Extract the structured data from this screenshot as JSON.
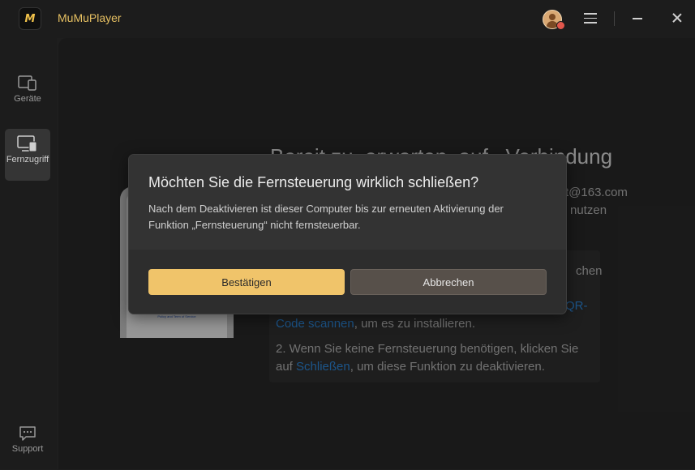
{
  "app": {
    "title": "MuMuPlayer",
    "logo_text": "M"
  },
  "titlebar": {
    "avatar_icon": "user-avatar-icon",
    "menu_icon": "hamburger-menu-icon",
    "minimize_icon": "minimize-icon",
    "close_icon": "close-icon"
  },
  "sidebar": {
    "items": [
      {
        "label": "Geräte",
        "icon": "devices-icon",
        "active": false
      },
      {
        "label": "Fernzugriff",
        "icon": "remote-access-icon",
        "active": true
      },
      {
        "label": "Support",
        "icon": "chat-support-icon",
        "active": false
      }
    ]
  },
  "background": {
    "heading": "Bereit zu..erwarten..auf...Verbindung",
    "email_fragment": "t@163.com",
    "use_fragment": "nutzen",
    "phone_policy": "Policy and Term of Service",
    "info": {
      "line1_end": "chen",
      "qr_fragment": "QR-",
      "code_link": "Code scannen",
      "line3_rest": ", um es zu installieren.",
      "line4": "2. Wenn Sie keine Fernsteuerung benötigen, klicken Sie",
      "line5_prefix": "auf ",
      "close_link": "Schließen",
      "line5_rest": ", um diese Funktion zu deaktivieren."
    }
  },
  "dialog": {
    "title": "Möchten Sie die Fernsteuerung wirklich schließen?",
    "message_line1": "Nach dem Deaktivieren ist dieser Computer bis zur erneuten Aktivierung der",
    "message_line2": "Funktion „Fernsteuerung“ nicht fernsteuerbar.",
    "confirm_label": "Bestätigen",
    "cancel_label": "Abbrechen"
  },
  "colors": {
    "accent": "#f0c46a",
    "link": "#2f8ee6",
    "title_gold": "#e6c062"
  }
}
